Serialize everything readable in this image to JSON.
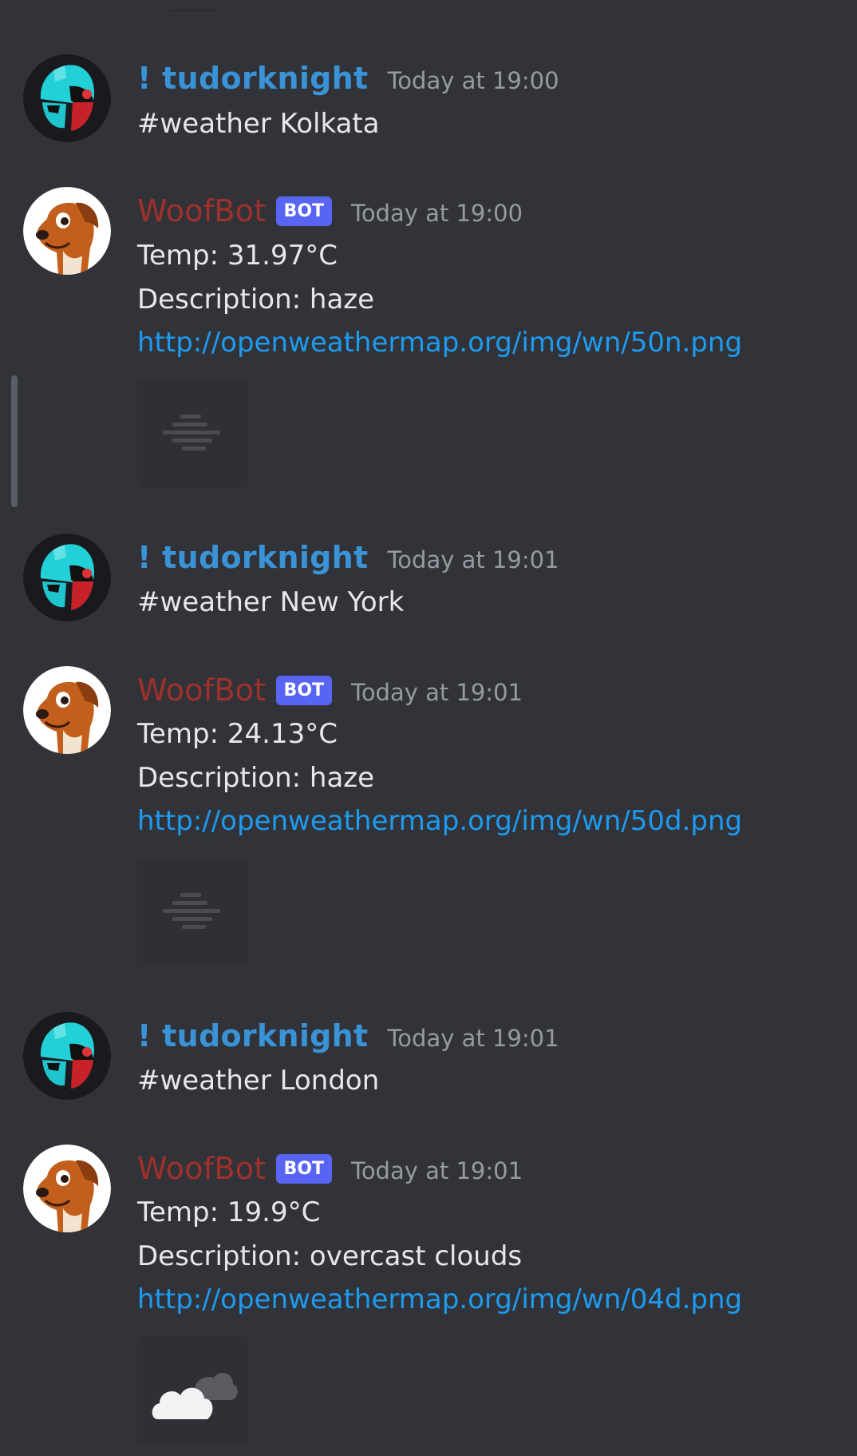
{
  "messages": [
    {
      "author": "! tudorknight",
      "time": "Today at 19:00",
      "lines": [
        "#weather Kolkata"
      ]
    },
    {
      "author": "WoofBot",
      "badge": "BOT",
      "time": "Today at 19:00",
      "temp": "Temp: 31.97°C",
      "desc": "Description: haze",
      "link": "http://openweathermap.org/img/wn/50n.png",
      "icon": "haze-icon"
    },
    {
      "author": "! tudorknight",
      "time": "Today at 19:01",
      "lines": [
        "#weather New York"
      ]
    },
    {
      "author": "WoofBot",
      "badge": "BOT",
      "time": "Today at 19:01",
      "temp": "Temp: 24.13°C",
      "desc": "Description: haze",
      "link": "http://openweathermap.org/img/wn/50d.png",
      "icon": "haze-icon"
    },
    {
      "author": "! tudorknight",
      "time": "Today at 19:01",
      "lines": [
        "#weather London"
      ]
    },
    {
      "author": "WoofBot",
      "badge": "BOT",
      "time": "Today at 19:01",
      "temp": "Temp: 19.9°C",
      "desc": "Description: overcast clouds",
      "link": "http://openweathermap.org/img/wn/04d.png",
      "icon": "cloud-icon"
    }
  ],
  "colors": {
    "background": "#313338",
    "user_name": "#3a93d6",
    "bot_name": "#a0302b",
    "bot_badge": "#5865f2",
    "link": "#1d9bf0",
    "timestamp": "#989aa2"
  }
}
